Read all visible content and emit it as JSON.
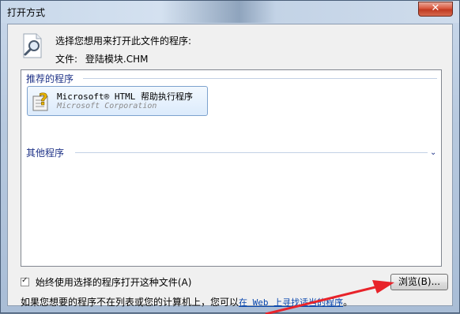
{
  "window": {
    "title": "打开方式",
    "close_glyph": "✕"
  },
  "header": {
    "prompt": "选择您想用来打开此文件的程序:",
    "file_label": "文件:",
    "file_name": "登陆模块.CHM"
  },
  "recommended": {
    "header": "推荐的程序",
    "programs": [
      {
        "name": "Microsoft® HTML 帮助执行程序",
        "company": "Microsoft Corporation",
        "icon": "help-question-icon"
      }
    ]
  },
  "other": {
    "header": "其他程序",
    "expand_glyph": "⌄"
  },
  "always_use": {
    "label": "始终使用选择的程序打开这种文件(A)",
    "checked": true
  },
  "browse_label": "浏览(B)...",
  "footer": {
    "text": "如果您想要的程序不在列表或您的计算机上，您可以",
    "link": "在 Web 上寻找适当的程序",
    "suffix": "。"
  },
  "colors": {
    "annotation_arrow": "#e8232a",
    "link": "#0645ad",
    "group_header": "#1e3287"
  }
}
